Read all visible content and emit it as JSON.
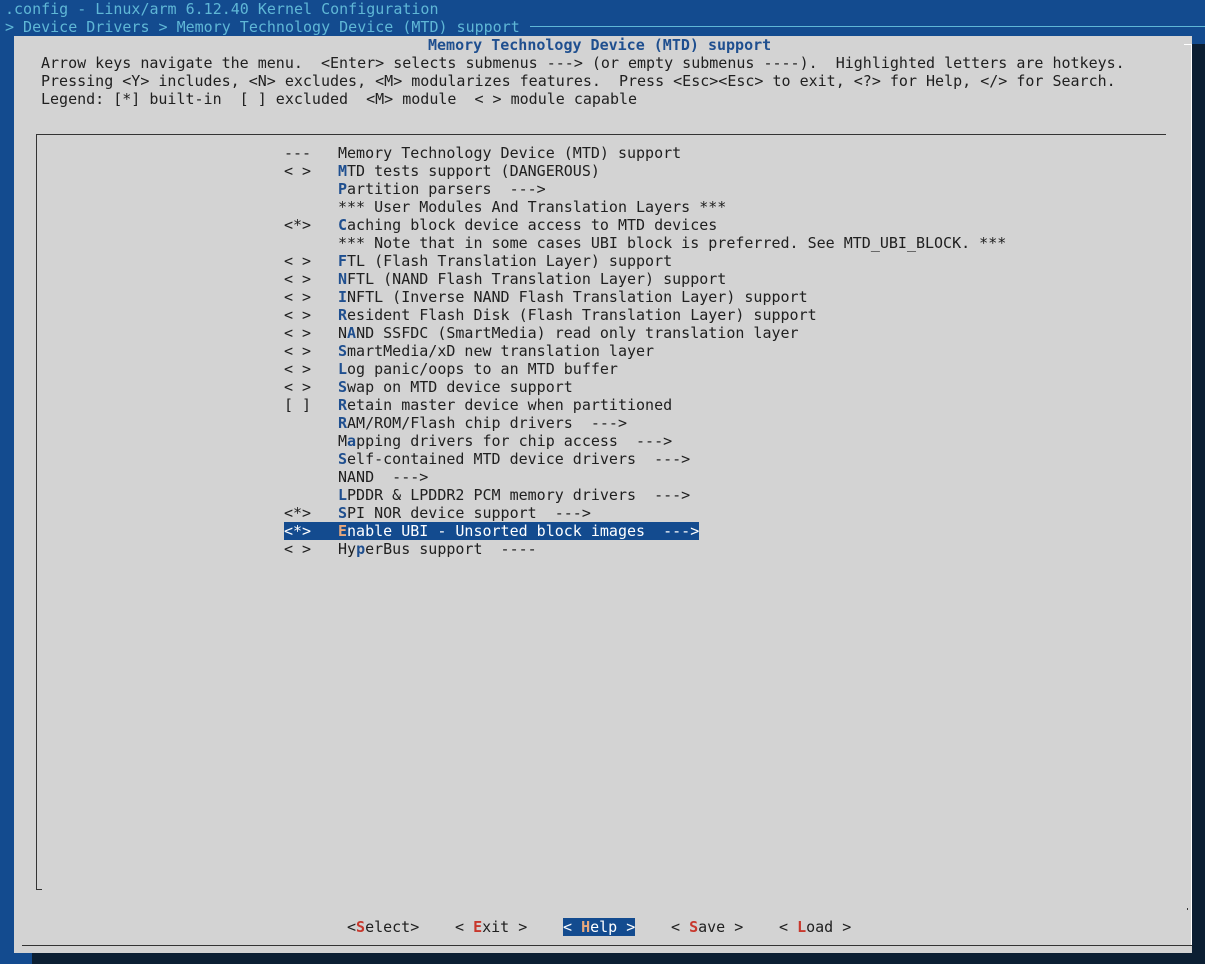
{
  "window": {
    "title": ".config - Linux/arm 6.12.40 Kernel Configuration",
    "breadcrumb": "> Device Drivers > Memory Technology Device (MTD) support"
  },
  "dialog": {
    "title": "Memory Technology Device (MTD) support",
    "help_lines": [
      "Arrow keys navigate the menu.  <Enter> selects submenus ---> (or empty submenus ----).  Highlighted letters are hotkeys.",
      "Pressing <Y> includes, <N> excludes, <M> modularizes features.  Press <Esc><Esc> to exit, <?> for Help, </> for Search.",
      "Legend: [*] built-in  [ ] excluded  <M> module  < > module capable"
    ]
  },
  "menu": {
    "items": [
      {
        "state": "---",
        "hot": "",
        "rest": "Memory Technology Device (MTD) support",
        "pre": ""
      },
      {
        "state": "< >",
        "hot": "M",
        "rest": "TD tests support (DANGEROUS)",
        "pre": ""
      },
      {
        "state": "",
        "hot": "P",
        "rest": "artition parsers  --->",
        "pre": ""
      },
      {
        "state": "",
        "hot": "",
        "rest": "*** User Modules And Translation Layers ***",
        "pre": ""
      },
      {
        "state": "<*>",
        "hot": "C",
        "rest": "aching block device access to MTD devices",
        "pre": ""
      },
      {
        "state": "",
        "hot": "",
        "rest": "*** Note that in some cases UBI block is preferred. See MTD_UBI_BLOCK. ***",
        "pre": ""
      },
      {
        "state": "< >",
        "hot": "F",
        "rest": "TL (Flash Translation Layer) support",
        "pre": ""
      },
      {
        "state": "< >",
        "hot": "N",
        "rest": "FTL (NAND Flash Translation Layer) support",
        "pre": ""
      },
      {
        "state": "< >",
        "hot": "I",
        "rest": "NFTL (Inverse NAND Flash Translation Layer) support",
        "pre": ""
      },
      {
        "state": "< >",
        "hot": "R",
        "rest": "esident Flash Disk (Flash Translation Layer) support",
        "pre": ""
      },
      {
        "state": "< >",
        "hot": "A",
        "rest": "ND SSFDC (SmartMedia) read only translation layer",
        "pre": "N"
      },
      {
        "state": "< >",
        "hot": "S",
        "rest": "martMedia/xD new translation layer",
        "pre": ""
      },
      {
        "state": "< >",
        "hot": "L",
        "rest": "og panic/oops to an MTD buffer",
        "pre": ""
      },
      {
        "state": "< >",
        "hot": "S",
        "rest": "wap on MTD device support",
        "pre": ""
      },
      {
        "state": "[ ]",
        "hot": "R",
        "rest": "etain master device when partitioned",
        "pre": ""
      },
      {
        "state": "",
        "hot": "R",
        "rest": "AM/ROM/Flash chip drivers  --->",
        "pre": ""
      },
      {
        "state": "",
        "hot": "a",
        "rest": "pping drivers for chip access  --->",
        "pre": "M"
      },
      {
        "state": "",
        "hot": "S",
        "rest": "elf-contained MTD device drivers  --->",
        "pre": ""
      },
      {
        "state": "",
        "hot": "",
        "rest": "NAND  --->",
        "pre": ""
      },
      {
        "state": "",
        "hot": "L",
        "rest": "PDDR & LPDDR2 PCM memory drivers  --->",
        "pre": ""
      },
      {
        "state": "<*>",
        "hot": "S",
        "rest": "PI NOR device support  --->",
        "pre": ""
      },
      {
        "state": "<*>",
        "hot": "E",
        "rest": "nable UBI - Unsorted block images  --->",
        "pre": "",
        "selected": true
      },
      {
        "state": "< >",
        "hot": "p",
        "rest": "erBus support  ----",
        "pre": "Hy"
      }
    ]
  },
  "buttons": {
    "select": {
      "open": "<",
      "hot": "S",
      "rest": "elect>"
    },
    "exit": {
      "open": "< ",
      "hot": "E",
      "rest": "xit >"
    },
    "help": {
      "open": "< ",
      "hot": "H",
      "rest": "elp >"
    },
    "save": {
      "open": "< ",
      "hot": "S",
      "rest": "ave >"
    },
    "load": {
      "open": "< ",
      "hot": "L",
      "rest": "oad >"
    }
  }
}
